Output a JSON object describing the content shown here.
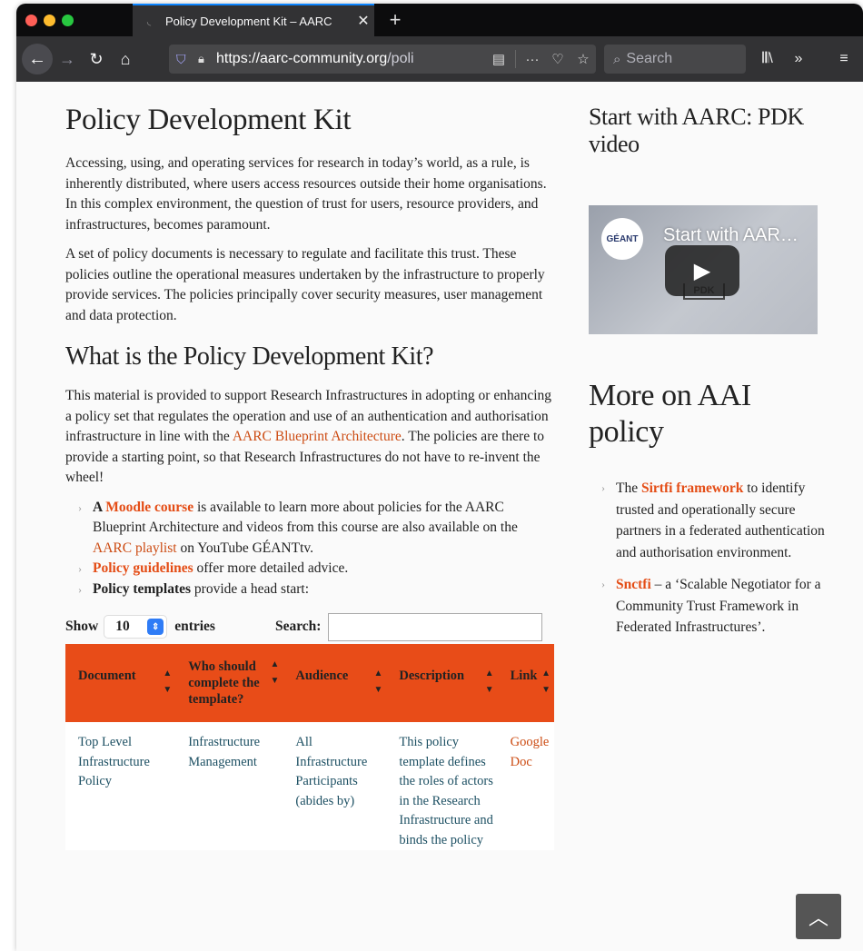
{
  "browser": {
    "tab_title": "Policy Development Kit – AARC",
    "url_domain": "https://aarc-community.org",
    "url_path": "/poli",
    "search_placeholder": "Search"
  },
  "main": {
    "title": "Policy Development Kit",
    "intro_p1": "Accessing, using, and operating services for research in today’s world, as a rule, is inherently distributed, where users access resources outside their home organisations. In this complex environment, the question of trust for users, resource providers, and infrastructures, becomes paramount.",
    "intro_p2": "A set of policy documents is necessary to regulate and facilitate this trust. These policies outline the operational measures undertaken by the infrastructure to properly provide services. The policies principally cover security measures, user management and data protection.",
    "section_title": "What is the Policy Development Kit?",
    "section_p_before": "This material is provided to support Research Infrastructures in adopting or enhancing a policy set that regulates the operation and use of an authentication and authorisation infrastructure in line with the ",
    "section_p_link": "AARC Blueprint Architecture",
    "section_p_after": ". The policies are there to provide a starting point, so that Research Infrastructures do not have to re-invent the wheel!",
    "bullet1_a": "A ",
    "bullet1_link": "Moodle course",
    "bullet1_b": " is available to learn more about policies for the AARC Blueprint Architecture and videos from this course are also available on the ",
    "bullet1_link2": "AARC playlist",
    "bullet1_c": " on YouTube GÉANTtv.",
    "bullet2_link": "Policy guidelines",
    "bullet2_rest": " offer more detailed advice.",
    "bullet3_bold": "Policy templates",
    "bullet3_rest": " provide a head start:"
  },
  "table": {
    "show_label": "Show",
    "entries_value": "10",
    "entries_label": "entries",
    "search_label": "Search:",
    "headers": [
      "Document",
      "Who should complete the template?",
      "Audience",
      "Description",
      "Link"
    ],
    "rows": [
      {
        "document": "Top Level Infrastructure Policy",
        "who": "Infrastructure Management",
        "audience": "All Infrastructure Participants (abides by)",
        "description": "This policy template defines the roles of actors in the Research Infrastructure and binds the policy",
        "link": "Google Doc"
      }
    ]
  },
  "sidebar": {
    "video_heading": "Start with AARC: PDK video",
    "video_title": "Start with AAR…",
    "video_logo": "GÉANT",
    "video_badge": "PDK",
    "more_heading": "More on AAI policy",
    "item1_link": "Sirtfi framework",
    "item1_before": "The ",
    "item1_rest": " to identify trusted and operationally secure partners in a federated authentication and authorisation environment.",
    "item2_link": "Snctfi",
    "item2_rest": " – a ‘Scalable Negotiator for a Community Trust Framework in Federated Infrastructures’."
  }
}
